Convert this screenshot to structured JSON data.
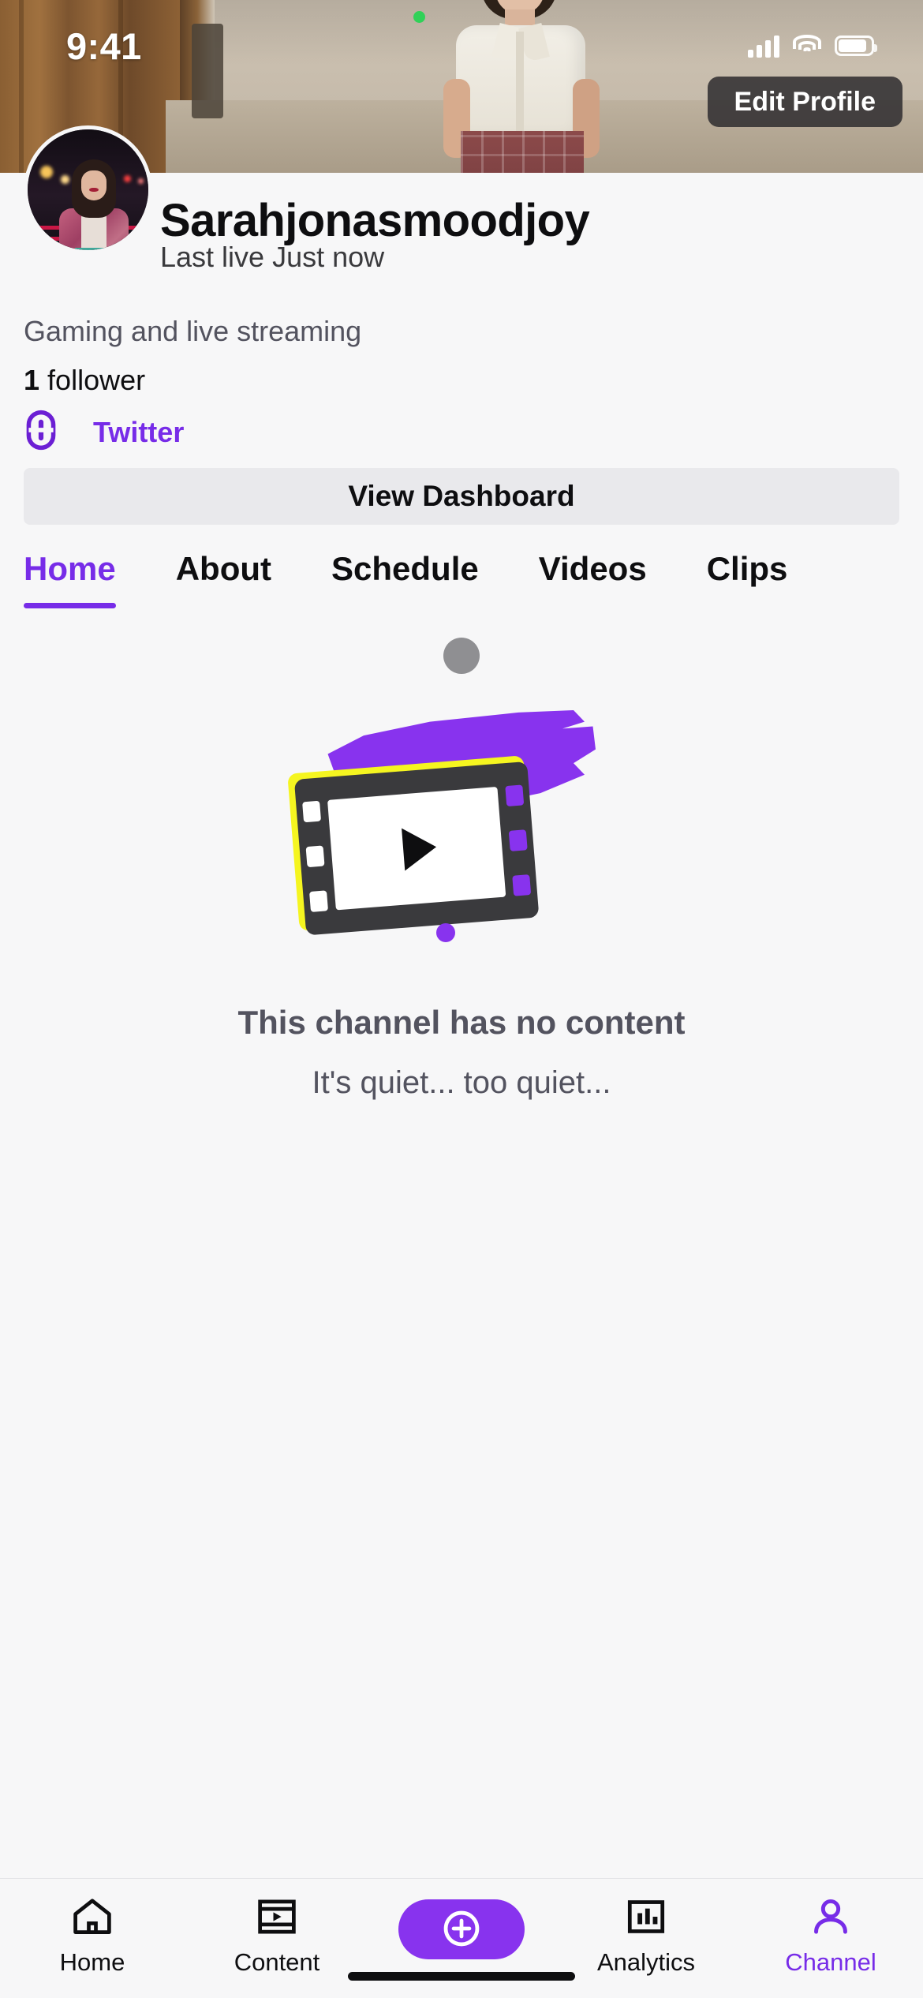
{
  "status_bar": {
    "time": "9:41",
    "cellular_icon": "signal-bars-icon",
    "wifi_icon": "wifi-icon",
    "battery_icon": "battery-icon"
  },
  "banner": {
    "edit_profile_label": "Edit Profile",
    "recording_indicator": "green-status-dot"
  },
  "profile": {
    "avatar_alt": "avatar",
    "username": "Sarahjonasmoodjoy",
    "last_live": "Last live Just now",
    "bio": "Gaming and live streaming",
    "follower_count": "1",
    "follower_label": "follower",
    "social": {
      "icon": "link-icon",
      "label": "Twitter"
    },
    "dashboard_button": "View Dashboard"
  },
  "tabs": [
    {
      "label": "Home",
      "active": true
    },
    {
      "label": "About",
      "active": false
    },
    {
      "label": "Schedule",
      "active": false
    },
    {
      "label": "Videos",
      "active": false
    },
    {
      "label": "Clips",
      "active": false
    }
  ],
  "empty_state": {
    "illustration": "film-strip-illustration",
    "title": "This channel has no content",
    "subtitle": "It's quiet... too quiet..."
  },
  "bottom_nav": [
    {
      "label": "Home",
      "icon": "house-icon",
      "active": false
    },
    {
      "label": "Content",
      "icon": "film-icon",
      "active": false
    },
    {
      "label": "",
      "icon": "plus-circle-icon",
      "active": false
    },
    {
      "label": "Analytics",
      "icon": "bar-chart-icon",
      "active": false
    },
    {
      "label": "Channel",
      "icon": "person-icon",
      "active": true
    }
  ],
  "colors": {
    "accent": "#772ce8",
    "accent_bright": "#8833ee",
    "text_primary": "#0e0e10",
    "text_secondary": "#53535f",
    "background": "#f7f7f8",
    "button_surface": "#e9e9ec",
    "online_dot": "#30d158",
    "illustration_yellow": "#f5f520"
  }
}
